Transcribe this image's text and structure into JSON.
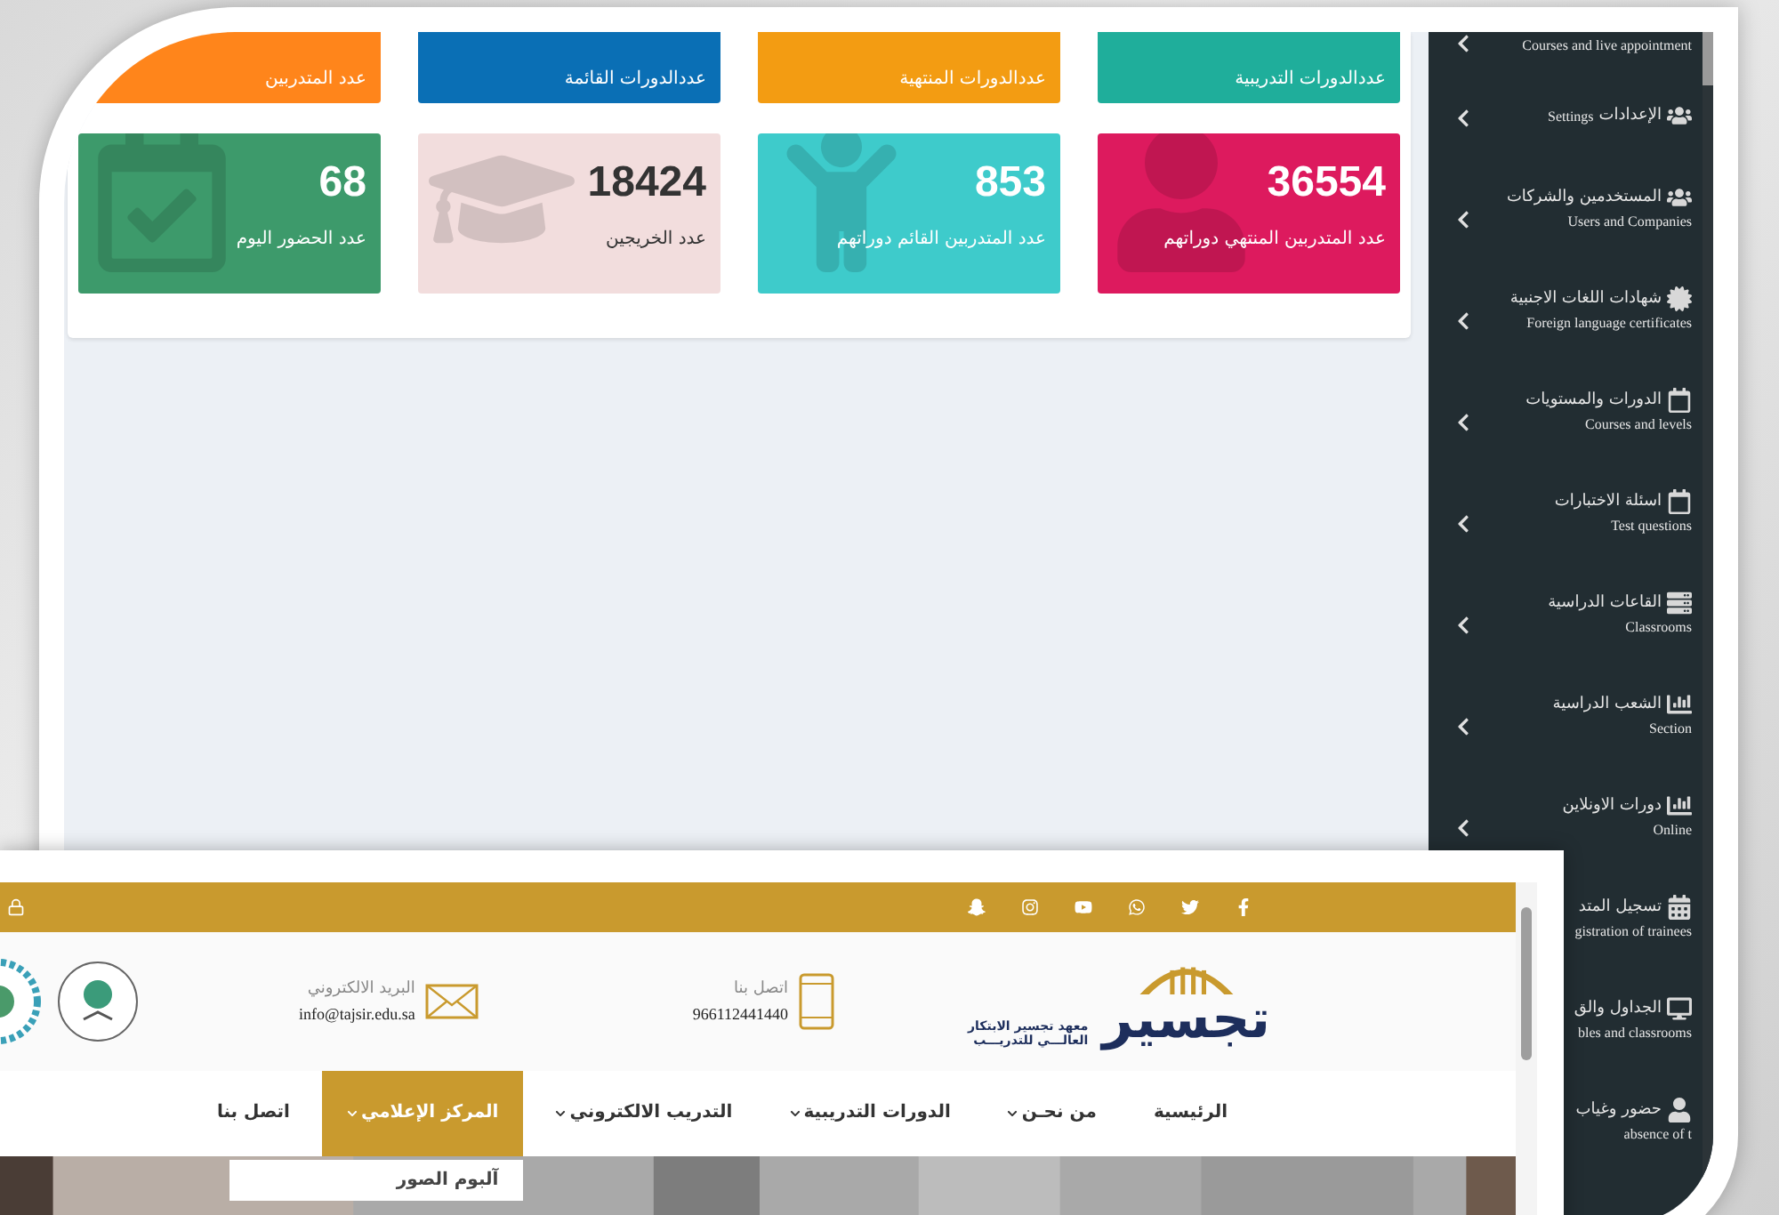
{
  "dashboard": {
    "top_tiles": [
      {
        "label": "عددالدورات التدريبية",
        "color": "#1fae9b"
      },
      {
        "label": "عددالدورات المنتهية",
        "color": "#f39c12"
      },
      {
        "label": "عددالدورات القائمة",
        "color": "#0a6fb5"
      },
      {
        "label": "عدد المتدربين",
        "color": "#ff851b"
      }
    ],
    "stat_tiles": [
      {
        "value": "36554",
        "label": "عدد المتدربين المنتهي دوراتهم",
        "color": "#dd1a5e",
        "kind": "person"
      },
      {
        "value": "853",
        "label": "عدد المتدربين القائم دوراتهم",
        "color": "#3ecbcb",
        "kind": "child"
      },
      {
        "value": "18424",
        "label": "عدد الخريجين",
        "color": "#f2dddd",
        "kind": "graduation"
      },
      {
        "value": "68",
        "label": "عدد الحضور اليوم",
        "color": "#3d9a6b",
        "kind": "calendar"
      }
    ]
  },
  "sidebar": {
    "items": [
      {
        "en": "Courses and live appointment",
        "chevron": true
      },
      {
        "kind": "users",
        "ar": "الإعدادات",
        "en": "Settings",
        "inline": true,
        "chevron": true
      },
      {
        "kind": "users",
        "ar": "المستخدمين والشركات",
        "en": "Users and Companies",
        "chevron": true
      },
      {
        "kind": "certificate",
        "ar": "شهادات اللغات الاجنبية",
        "en": "Foreign language certificates",
        "chevron": true
      },
      {
        "kind": "calendar",
        "ar": "الدورات والمستويات",
        "en": "Courses and levels",
        "chevron": true
      },
      {
        "kind": "calendar",
        "ar": "اسئلة الاختبارات",
        "en": "Test questions",
        "chevron": true
      },
      {
        "kind": "server",
        "ar": "القاعات الدراسية",
        "en": "Classrooms",
        "chevron": true
      },
      {
        "kind": "chart",
        "ar": "الشعب الدراسية",
        "en": "Section",
        "chevron": true
      },
      {
        "kind": "chart",
        "ar": "دورات الاونلاين",
        "en": "Online",
        "chevron": true
      },
      {
        "kind": "calendar-grid",
        "ar": "تسجيل المتد",
        "en": "gistration of trainees",
        "chevron": false
      },
      {
        "kind": "monitor",
        "ar": "الجداول والق",
        "en": "bles and classrooms",
        "chevron": false
      },
      {
        "kind": "person",
        "ar": "حضور وغياب",
        "en": "absence of t",
        "chevron": false
      }
    ]
  },
  "website": {
    "logo": {
      "name": "تجسير",
      "line_1": "معهد تجسير الابتكار",
      "line_2": "العالـــي للتدريـــب"
    },
    "contact": {
      "label": "اتصل بنا",
      "value": "966112441440"
    },
    "email": {
      "label": "البريد الالكتروني",
      "value": "info@tajsir.edu.sa"
    },
    "nav": [
      {
        "label": "الرئيسية",
        "dropdown": false,
        "selected": false
      },
      {
        "label": "من نحـن",
        "dropdown": true,
        "selected": false
      },
      {
        "label": "الدورات التدريبية",
        "dropdown": true,
        "selected": false
      },
      {
        "label": "التدريب الالكتروني",
        "dropdown": true,
        "selected": false
      },
      {
        "label": "المركز الإعلامي",
        "dropdown": true,
        "selected": true
      },
      {
        "label": "اتصل بنا",
        "dropdown": false,
        "selected": false
      }
    ],
    "dropdown_menu": [
      "آلبوم الصور"
    ]
  }
}
